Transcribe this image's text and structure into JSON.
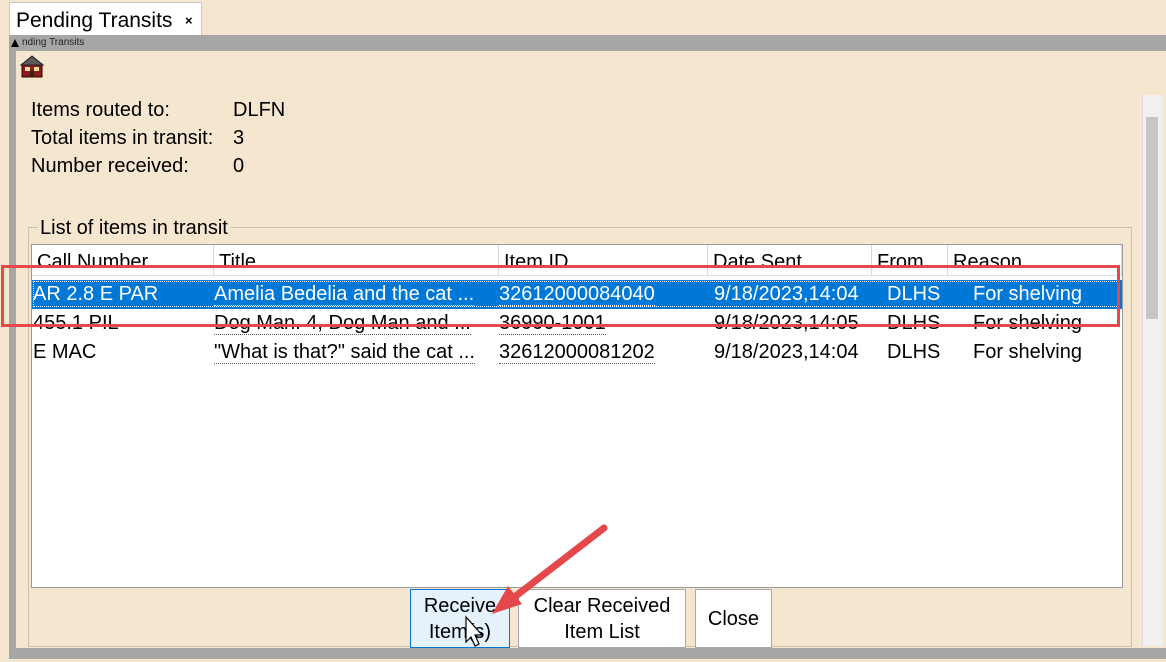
{
  "tab": {
    "label": "Pending Transits",
    "close": "×"
  },
  "panel": {
    "title": "nding Transits"
  },
  "info": {
    "routed_to_label": "Items routed to:",
    "routed_to_value": "DLFN",
    "total_label": "Total items in transit:",
    "total_value": "3",
    "received_label": "Number received:",
    "received_value": "0"
  },
  "list": {
    "group_title": "List of items in transit",
    "columns": [
      "Call Number",
      "Title",
      "Item ID",
      "Date Sent",
      "From",
      "Reason"
    ],
    "rows": [
      {
        "call_number": "AR 2.8 E PAR",
        "title": "Amelia Bedelia and the cat ...",
        "item_id": "32612000084040",
        "date_sent": "9/18/2023,14:04",
        "from": "DLHS",
        "reason": "For shelving",
        "selected": true
      },
      {
        "call_number": "455.1 PIL",
        "title": "Dog Man. 4, Dog Man and ...",
        "item_id": "36990-1001",
        "date_sent": "9/18/2023,14:05",
        "from": "DLHS",
        "reason": "For shelving",
        "selected": false
      },
      {
        "call_number": "E MAC",
        "title": "\"What is that?\" said the cat ...",
        "item_id": "32612000081202",
        "date_sent": "9/18/2023,14:04",
        "from": "DLHS",
        "reason": "For shelving",
        "selected": false
      }
    ]
  },
  "buttons": {
    "receive_line1": "Receive",
    "receive_line2": "Item(s)",
    "clear_line1": "Clear Received",
    "clear_line2": "Item List",
    "close": "Close"
  },
  "colors": {
    "selection": "#0078d7",
    "annotation": "#e5474a",
    "panel_bg": "#f5e6cf"
  },
  "icons": [
    "home-icon",
    "collapse-icon",
    "close-icon",
    "arrow-annotation",
    "mouse-cursor-icon"
  ]
}
